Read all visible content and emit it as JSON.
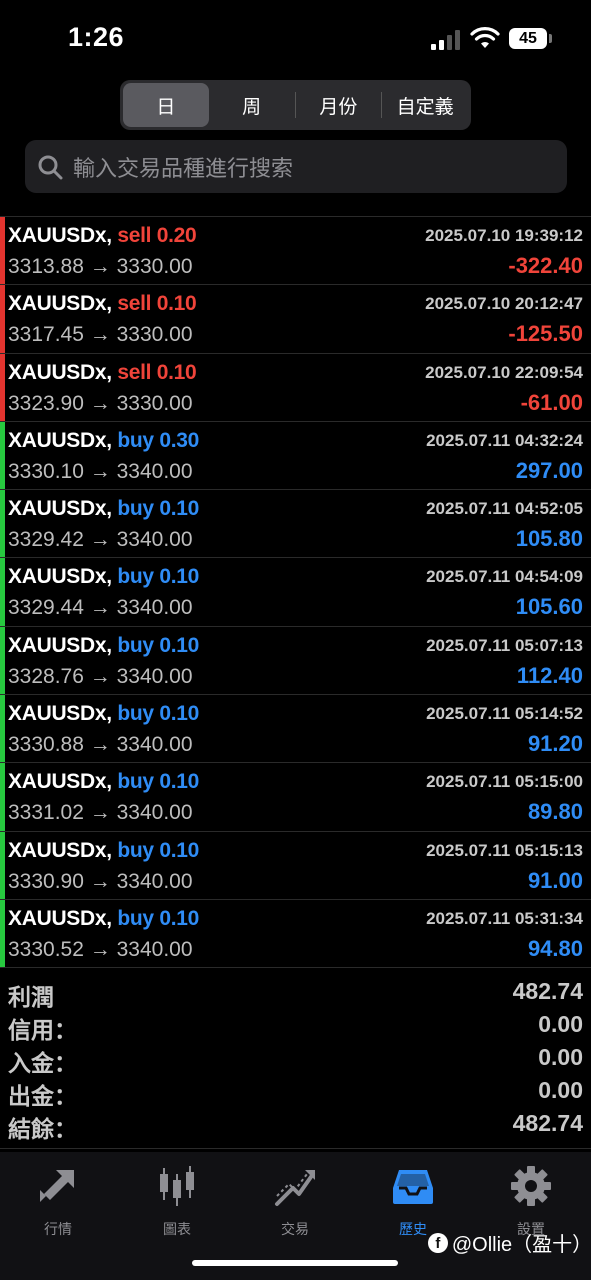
{
  "status": {
    "time": "1:26",
    "battery": "45"
  },
  "segments": [
    "日",
    "周",
    "月份",
    "自定義"
  ],
  "search": {
    "placeholder": "輸入交易品種進行搜索"
  },
  "trades": [
    {
      "symbol": "XAUUSDx,",
      "side": "sell",
      "volume": "0.20",
      "time": "2025.07.10 19:39:12",
      "open": "3313.88",
      "close": "3330.00",
      "profit": "-322.40"
    },
    {
      "symbol": "XAUUSDx,",
      "side": "sell",
      "volume": "0.10",
      "time": "2025.07.10 20:12:47",
      "open": "3317.45",
      "close": "3330.00",
      "profit": "-125.50"
    },
    {
      "symbol": "XAUUSDx,",
      "side": "sell",
      "volume": "0.10",
      "time": "2025.07.10 22:09:54",
      "open": "3323.90",
      "close": "3330.00",
      "profit": "-61.00"
    },
    {
      "symbol": "XAUUSDx,",
      "side": "buy",
      "volume": "0.30",
      "time": "2025.07.11 04:32:24",
      "open": "3330.10",
      "close": "3340.00",
      "profit": "297.00"
    },
    {
      "symbol": "XAUUSDx,",
      "side": "buy",
      "volume": "0.10",
      "time": "2025.07.11 04:52:05",
      "open": "3329.42",
      "close": "3340.00",
      "profit": "105.80"
    },
    {
      "symbol": "XAUUSDx,",
      "side": "buy",
      "volume": "0.10",
      "time": "2025.07.11 04:54:09",
      "open": "3329.44",
      "close": "3340.00",
      "profit": "105.60"
    },
    {
      "symbol": "XAUUSDx,",
      "side": "buy",
      "volume": "0.10",
      "time": "2025.07.11 05:07:13",
      "open": "3328.76",
      "close": "3340.00",
      "profit": "112.40"
    },
    {
      "symbol": "XAUUSDx,",
      "side": "buy",
      "volume": "0.10",
      "time": "2025.07.11 05:14:52",
      "open": "3330.88",
      "close": "3340.00",
      "profit": "91.20"
    },
    {
      "symbol": "XAUUSDx,",
      "side": "buy",
      "volume": "0.10",
      "time": "2025.07.11 05:15:00",
      "open": "3331.02",
      "close": "3340.00",
      "profit": "89.80"
    },
    {
      "symbol": "XAUUSDx,",
      "side": "buy",
      "volume": "0.10",
      "time": "2025.07.11 05:15:13",
      "open": "3330.90",
      "close": "3340.00",
      "profit": "91.00"
    },
    {
      "symbol": "XAUUSDx,",
      "side": "buy",
      "volume": "0.10",
      "time": "2025.07.11 05:31:34",
      "open": "3330.52",
      "close": "3340.00",
      "profit": "94.80"
    }
  ],
  "arrow": "→",
  "summary": [
    {
      "label": "利潤",
      "value": "482.74"
    },
    {
      "label": "信用：",
      "value": "0.00"
    },
    {
      "label": "入金：",
      "value": "0.00"
    },
    {
      "label": "出金：",
      "value": "0.00"
    },
    {
      "label": "結餘：",
      "value": "482.74"
    }
  ],
  "tabs": [
    {
      "label": "行情",
      "icon": "quotes-arrows-icon"
    },
    {
      "label": "圖表",
      "icon": "candlestick-chart-icon"
    },
    {
      "label": "交易",
      "icon": "trade-trend-icon"
    },
    {
      "label": "歷史",
      "icon": "history-inbox-icon",
      "active": true
    },
    {
      "label": "設置",
      "icon": "settings-gear-icon"
    }
  ],
  "watermark": "@Ollie（盈十）",
  "colors": {
    "sell": "#f0443a",
    "buy": "#2f8cf5",
    "sell_bar": "#e3342f",
    "buy_bar": "#27c93f",
    "active_tab": "#2f8cf5"
  }
}
